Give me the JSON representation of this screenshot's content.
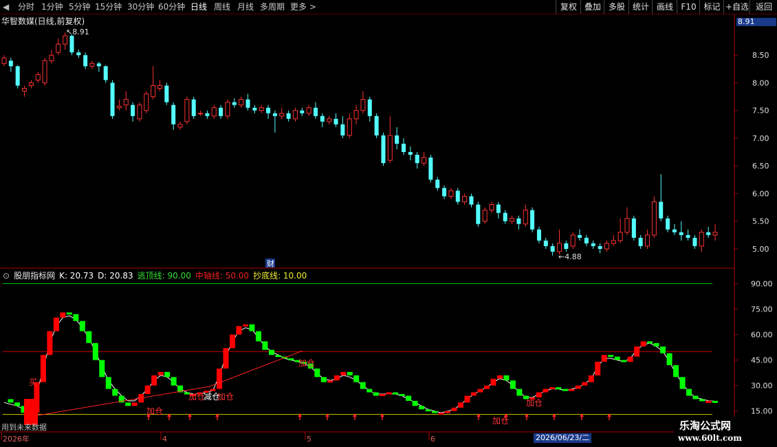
{
  "toolbar": {
    "periods": [
      {
        "label": "分时",
        "active": false
      },
      {
        "label": "1分钟",
        "active": false
      },
      {
        "label": "5分钟",
        "active": false
      },
      {
        "label": "15分钟",
        "active": false
      },
      {
        "label": "30分钟",
        "active": false
      },
      {
        "label": "60分钟",
        "active": false
      },
      {
        "label": "日线",
        "active": true
      },
      {
        "label": "周线",
        "active": false
      },
      {
        "label": "月线",
        "active": false
      },
      {
        "label": "多周期",
        "active": false
      },
      {
        "label": "更多",
        "active": false
      }
    ],
    "right_buttons": [
      "复权",
      "叠加",
      "多股",
      "统计",
      "画线",
      "F10",
      "标记",
      "+自选",
      "返回"
    ]
  },
  "chart_title": "华智数媒(日线,前复权)",
  "current_price_tag": "8.91",
  "price_panel": {
    "y_ticks": [
      "8.50",
      "8.00",
      "7.50",
      "7.00",
      "6.50",
      "6.00",
      "5.50",
      "5.00"
    ],
    "high_annotation": "8.91",
    "low_annotation": "4.88",
    "event_marker": "财"
  },
  "indicator": {
    "name": "股朋指标网",
    "k_label": "K: 20.73",
    "d_label": "D: 20.83",
    "escape_label": "逃顶线: 90.00",
    "mid_label": "中轴线: 50.00",
    "bottom_label": "抄底线: 10.00",
    "y_ticks": [
      "90.00",
      "75.00",
      "60.00",
      "45.00",
      "30.00",
      "15.00"
    ],
    "signals": [
      "买",
      "加仓",
      "加仓",
      "减仓",
      "加仓",
      "加仓",
      "加仓",
      "加仓"
    ]
  },
  "dates": [
    "2026年",
    "4",
    "5",
    "6"
  ],
  "status_date": "2026/06/23/二",
  "footnote": "用到未来数据",
  "watermark": {
    "line1": "乐淘公式网",
    "line2": "www.60lt.com"
  },
  "colors": {
    "up": "#ff3232",
    "down": "#54ffff",
    "kd_up": "#ff0000",
    "kd_down": "#00ff00",
    "escape": "#00cc00",
    "mid": "#cc0000",
    "bottom": "#cccc00"
  },
  "chart_data": [
    {
      "type": "candlestick",
      "title": "华智数媒(日线,前复权)",
      "ylim": [
        4.8,
        9.0
      ],
      "candles": [
        [
          8.35,
          8.45,
          8.5,
          8.3
        ],
        [
          8.4,
          8.3,
          8.45,
          8.2
        ],
        [
          8.3,
          7.95,
          8.32,
          7.9
        ],
        [
          7.85,
          7.9,
          7.95,
          7.75
        ],
        [
          7.95,
          8.0,
          8.05,
          7.9
        ],
        [
          8.05,
          8.15,
          8.2,
          8.0
        ],
        [
          8.0,
          8.4,
          8.45,
          7.95
        ],
        [
          8.4,
          8.5,
          8.6,
          8.35
        ],
        [
          8.55,
          8.7,
          8.8,
          8.5
        ],
        [
          8.7,
          8.85,
          8.91,
          8.6
        ],
        [
          8.85,
          8.55,
          8.88,
          8.5
        ],
        [
          8.55,
          8.5,
          8.6,
          8.45
        ],
        [
          8.5,
          8.3,
          8.55,
          8.25
        ],
        [
          8.3,
          8.35,
          8.4,
          8.25
        ],
        [
          8.35,
          8.3,
          8.38,
          8.2
        ],
        [
          8.3,
          8.05,
          8.32,
          8.0
        ],
        [
          8.0,
          7.4,
          8.05,
          7.35
        ],
        [
          7.55,
          7.58,
          7.7,
          7.5
        ],
        [
          7.6,
          7.7,
          7.85,
          7.5
        ],
        [
          7.6,
          7.4,
          7.65,
          7.3
        ],
        [
          7.35,
          7.6,
          7.65,
          7.3
        ],
        [
          7.5,
          7.8,
          7.85,
          7.45
        ],
        [
          7.75,
          7.95,
          8.3,
          7.7
        ],
        [
          7.9,
          7.95,
          8.05,
          7.85
        ],
        [
          7.95,
          7.65,
          8.0,
          7.6
        ],
        [
          7.6,
          7.25,
          7.65,
          7.15
        ],
        [
          7.2,
          7.25,
          7.3,
          7.15
        ],
        [
          7.3,
          7.7,
          7.75,
          7.25
        ],
        [
          7.7,
          7.4,
          7.75,
          7.35
        ],
        [
          7.45,
          7.45,
          7.5,
          7.4
        ],
        [
          7.45,
          7.4,
          7.5,
          7.35
        ],
        [
          7.4,
          7.55,
          7.6,
          7.35
        ],
        [
          7.55,
          7.4,
          7.6,
          7.35
        ],
        [
          7.4,
          7.65,
          7.7,
          7.35
        ],
        [
          7.65,
          7.6,
          7.72,
          7.55
        ],
        [
          7.6,
          7.7,
          7.75,
          7.55
        ],
        [
          7.7,
          7.55,
          7.8,
          7.5
        ],
        [
          7.55,
          7.5,
          7.6,
          7.45
        ],
        [
          7.5,
          7.55,
          7.6,
          7.45
        ],
        [
          7.55,
          7.45,
          7.6,
          7.35
        ],
        [
          7.45,
          7.4,
          7.5,
          7.1
        ],
        [
          7.4,
          7.45,
          7.55,
          7.35
        ],
        [
          7.45,
          7.35,
          7.5,
          7.3
        ],
        [
          7.35,
          7.5,
          7.55,
          7.3
        ],
        [
          7.5,
          7.45,
          7.55,
          7.4
        ],
        [
          7.45,
          7.55,
          7.6,
          7.4
        ],
        [
          7.55,
          7.4,
          7.65,
          7.35
        ],
        [
          7.4,
          7.3,
          7.45,
          7.2
        ],
        [
          7.3,
          7.35,
          7.4,
          7.25
        ],
        [
          7.35,
          7.25,
          7.45,
          7.2
        ],
        [
          7.25,
          7.05,
          7.4,
          7.0
        ],
        [
          7.05,
          7.35,
          7.45,
          7.0
        ],
        [
          7.35,
          7.5,
          7.6,
          7.25
        ],
        [
          7.5,
          7.7,
          7.85,
          7.45
        ],
        [
          7.7,
          7.4,
          7.75,
          7.3
        ],
        [
          7.4,
          7.05,
          7.45,
          7.0
        ],
        [
          7.05,
          6.55,
          7.1,
          6.5
        ],
        [
          6.6,
          7.05,
          7.4,
          6.55
        ],
        [
          7.05,
          6.9,
          7.2,
          6.8
        ],
        [
          6.9,
          6.75,
          7.0,
          6.7
        ],
        [
          6.75,
          6.7,
          6.85,
          6.6
        ],
        [
          6.7,
          6.55,
          6.75,
          6.45
        ],
        [
          6.55,
          6.65,
          6.75,
          6.5
        ],
        [
          6.65,
          6.25,
          6.7,
          6.2
        ],
        [
          6.25,
          6.1,
          6.3,
          6.05
        ],
        [
          6.1,
          5.95,
          6.15,
          5.9
        ],
        [
          5.95,
          6.05,
          6.1,
          5.9
        ],
        [
          6.05,
          5.85,
          6.1,
          5.8
        ],
        [
          5.85,
          5.95,
          6.0,
          5.8
        ],
        [
          5.95,
          5.8,
          6.0,
          5.75
        ],
        [
          5.8,
          5.45,
          5.85,
          5.4
        ],
        [
          5.5,
          5.7,
          5.75,
          5.45
        ],
        [
          5.7,
          5.8,
          5.85,
          5.65
        ],
        [
          5.8,
          5.65,
          5.85,
          5.55
        ],
        [
          5.65,
          5.5,
          5.7,
          5.45
        ],
        [
          5.5,
          5.55,
          5.6,
          5.45
        ],
        [
          5.55,
          5.45,
          5.6,
          5.35
        ],
        [
          5.45,
          5.7,
          5.8,
          5.4
        ],
        [
          5.7,
          5.35,
          5.75,
          5.3
        ],
        [
          5.35,
          5.15,
          5.4,
          5.1
        ],
        [
          5.15,
          5.05,
          5.2,
          5.0
        ],
        [
          5.05,
          4.95,
          5.1,
          4.88
        ],
        [
          4.95,
          5.1,
          5.35,
          4.9
        ],
        [
          5.1,
          5.0,
          5.15,
          4.95
        ],
        [
          5.05,
          5.25,
          5.3,
          5.0
        ],
        [
          5.25,
          5.2,
          5.35,
          5.15
        ],
        [
          5.2,
          5.1,
          5.25,
          5.05
        ],
        [
          5.1,
          5.05,
          5.15,
          5.0
        ],
        [
          5.05,
          5.0,
          5.1,
          4.92
        ],
        [
          5.0,
          5.1,
          5.15,
          4.95
        ],
        [
          5.1,
          5.15,
          5.25,
          5.05
        ],
        [
          5.15,
          5.3,
          5.55,
          5.1
        ],
        [
          5.3,
          5.55,
          5.75,
          5.25
        ],
        [
          5.55,
          5.2,
          5.6,
          5.15
        ],
        [
          5.2,
          5.05,
          5.25,
          5.0
        ],
        [
          5.05,
          5.25,
          5.35,
          5.0
        ],
        [
          5.25,
          5.85,
          5.95,
          5.2
        ],
        [
          5.85,
          5.55,
          6.35,
          5.5
        ],
        [
          5.55,
          5.35,
          5.6,
          5.3
        ],
        [
          5.35,
          5.3,
          5.45,
          5.25
        ],
        [
          5.3,
          5.25,
          5.5,
          5.15
        ],
        [
          5.25,
          5.2,
          5.35,
          5.15
        ],
        [
          5.2,
          5.05,
          5.25,
          5.0
        ],
        [
          5.05,
          5.3,
          5.35,
          4.95
        ],
        [
          5.3,
          5.25,
          5.4,
          5.2
        ],
        [
          5.25,
          5.3,
          5.45,
          5.15
        ]
      ]
    },
    {
      "type": "line",
      "title": "股朋指标网",
      "ylim": [
        8,
        95
      ],
      "hlines": {
        "escape": 90,
        "mid": 50,
        "bottom": 13
      },
      "series": [
        {
          "name": "K",
          "values": [
            22,
            20,
            18,
            14,
            14,
            32,
            48,
            62,
            70,
            73,
            72,
            68,
            62,
            55,
            45,
            35,
            28,
            24,
            20,
            18,
            20,
            25,
            30,
            36,
            38,
            35,
            30,
            26,
            25,
            25,
            26,
            27,
            28,
            40,
            52,
            60,
            65,
            66,
            62,
            56,
            51,
            48,
            47,
            46,
            45,
            44,
            43,
            40,
            35,
            32,
            33,
            36,
            38,
            36,
            32,
            28,
            26,
            24,
            25,
            26,
            25,
            24,
            21,
            18,
            16,
            15,
            14,
            14,
            15,
            17,
            20,
            24,
            26,
            28,
            30,
            34,
            36,
            33,
            28,
            24,
            22,
            23,
            26,
            28,
            29,
            28,
            27,
            28,
            30,
            32,
            36,
            44,
            48,
            47,
            45,
            44,
            47,
            53,
            56,
            55,
            53,
            49,
            42,
            35,
            28,
            24,
            22,
            21,
            21,
            20.7
          ]
        },
        {
          "name": "D",
          "values": [
            20,
            19,
            18,
            16,
            15,
            25,
            40,
            55,
            65,
            70,
            71,
            69,
            64,
            58,
            50,
            41,
            33,
            28,
            24,
            21,
            21,
            24,
            28,
            33,
            36,
            35,
            32,
            28,
            26,
            25,
            25,
            26,
            27,
            36,
            47,
            56,
            62,
            64,
            63,
            58,
            53,
            50,
            48,
            46,
            45,
            44,
            43,
            41,
            37,
            34,
            33,
            34,
            36,
            35,
            33,
            30,
            27,
            25,
            25,
            25,
            25,
            24,
            22,
            20,
            18,
            16,
            15,
            14,
            15,
            16,
            19,
            22,
            25,
            27,
            29,
            32,
            34,
            33,
            30,
            26,
            23,
            23,
            25,
            27,
            28,
            28,
            27,
            28,
            29,
            31,
            34,
            41,
            46,
            46,
            45,
            44,
            46,
            51,
            54,
            55,
            53,
            50,
            44,
            37,
            31,
            26,
            23,
            22,
            21,
            20.8
          ]
        }
      ]
    }
  ]
}
